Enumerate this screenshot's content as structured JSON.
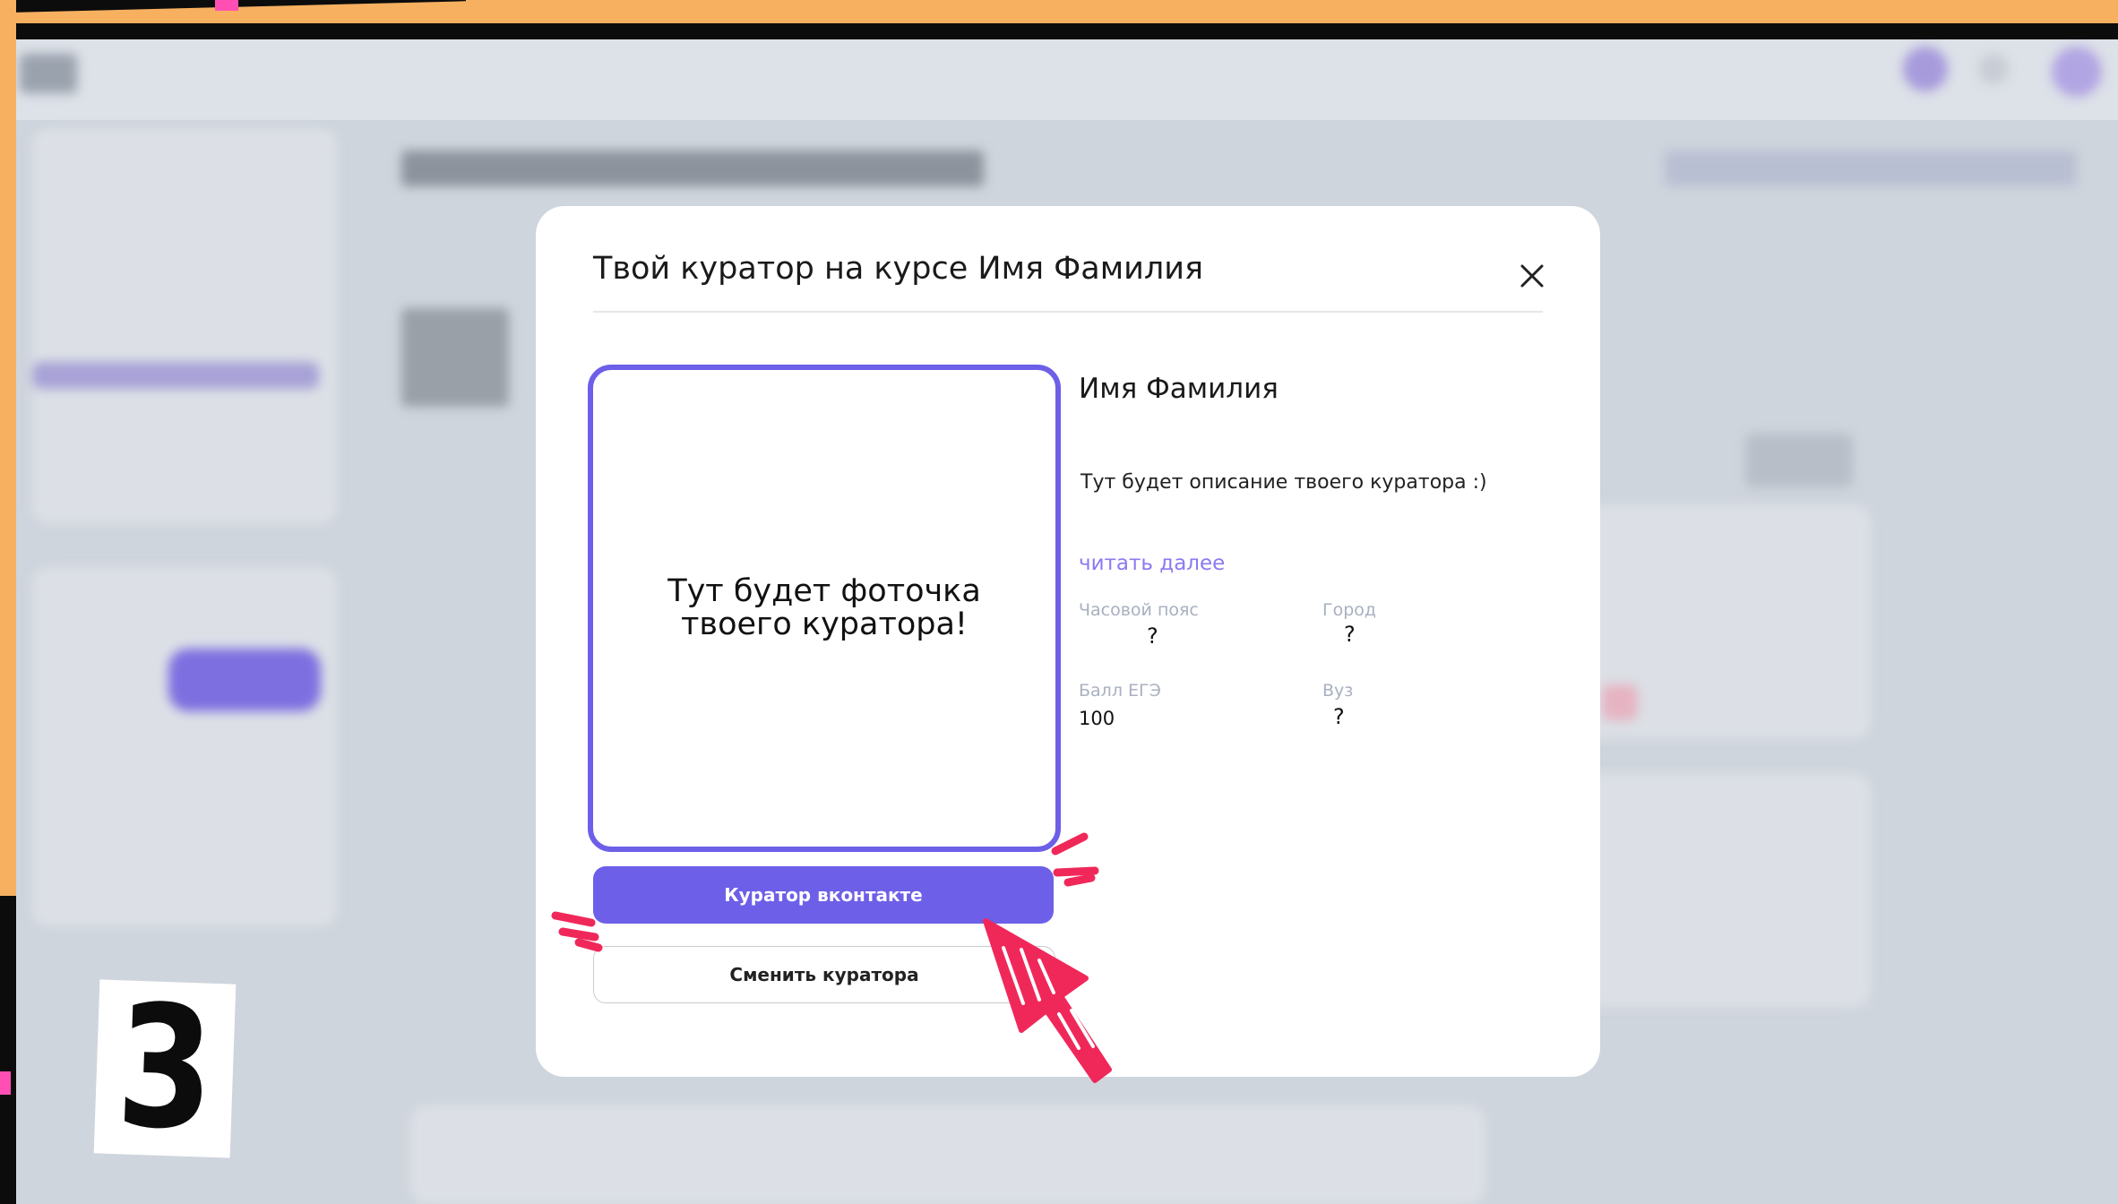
{
  "modal": {
    "title": "Твой куратор на курсе Имя Фамилия",
    "photo_placeholder": "Тут будет фоточка\nтвоего куратора!",
    "curator_name": "Имя Фамилия",
    "description": "Тут будет описание твоего куратора :)",
    "read_more": "читать далее",
    "fields": [
      {
        "label": "Часовой пояс",
        "value": "?"
      },
      {
        "label": "Город",
        "value": "?"
      },
      {
        "label": "Балл ЕГЭ",
        "value": "100"
      },
      {
        "label": "Вуз",
        "value": "?"
      }
    ],
    "vk_button": "Куратор вконтакте",
    "change_button": "Сменить куратора"
  },
  "step_badge": "3",
  "colors": {
    "accent": "#6e5fe8",
    "link": "#8a7af0",
    "frame_orange": "#f6b060",
    "arrow_pink": "#f0285a"
  },
  "icons": {
    "close": "close-icon",
    "pointer": "hand-drawn-arrow-icon"
  }
}
